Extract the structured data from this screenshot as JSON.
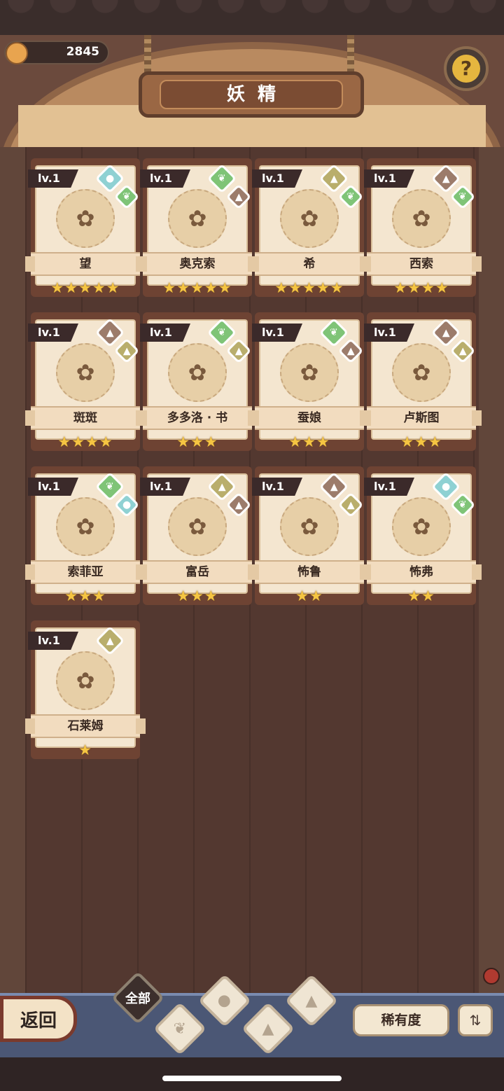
{
  "header": {
    "coin_value": "2845",
    "title": "妖精"
  },
  "fairies": [
    {
      "level": "lv.1",
      "name": "望",
      "stars": "★★★★★",
      "elements": [
        "water-icon",
        "plant-icon"
      ]
    },
    {
      "level": "lv.1",
      "name": "奥克索",
      "stars": "★★★★★",
      "elements": [
        "plant-icon",
        "rock-icon"
      ]
    },
    {
      "level": "lv.1",
      "name": "希",
      "stars": "★★★★★",
      "elements": [
        "earth-icon",
        "plant-icon"
      ]
    },
    {
      "level": "lv.1",
      "name": "西索",
      "stars": "★★★★",
      "elements": [
        "rock-icon",
        "plant-icon"
      ]
    },
    {
      "level": "lv.1",
      "name": "斑斑",
      "stars": "★★★★",
      "elements": [
        "rock-icon",
        "earth-icon"
      ]
    },
    {
      "level": "lv.1",
      "name": "多多洛 · 书",
      "stars": "★★★",
      "elements": [
        "plant-icon",
        "earth-icon"
      ]
    },
    {
      "level": "lv.1",
      "name": "蚕娘",
      "stars": "★★★",
      "elements": [
        "plant-icon",
        "rock-icon"
      ]
    },
    {
      "level": "lv.1",
      "name": "卢斯图",
      "stars": "★★★",
      "elements": [
        "rock-icon",
        "earth-icon"
      ]
    },
    {
      "level": "lv.1",
      "name": "索菲亚",
      "stars": "★★★",
      "elements": [
        "plant-icon",
        "water-icon"
      ]
    },
    {
      "level": "lv.1",
      "name": "富岳",
      "stars": "★★★",
      "elements": [
        "earth-icon",
        "rock-icon"
      ]
    },
    {
      "level": "lv.1",
      "name": "怖鲁",
      "stars": "★★",
      "elements": [
        "rock-icon",
        "earth-icon"
      ]
    },
    {
      "level": "lv.1",
      "name": "怖弗",
      "stars": "★★",
      "elements": [
        "water-icon",
        "plant-icon"
      ]
    },
    {
      "level": "lv.1",
      "name": "石莱姆",
      "stars": "★",
      "elements": [
        "earth-icon"
      ]
    }
  ],
  "footer": {
    "back_label": "返回",
    "tab_all_label": "全部",
    "sort_label": "稀有度",
    "order_icon": "sort-order-icon"
  }
}
